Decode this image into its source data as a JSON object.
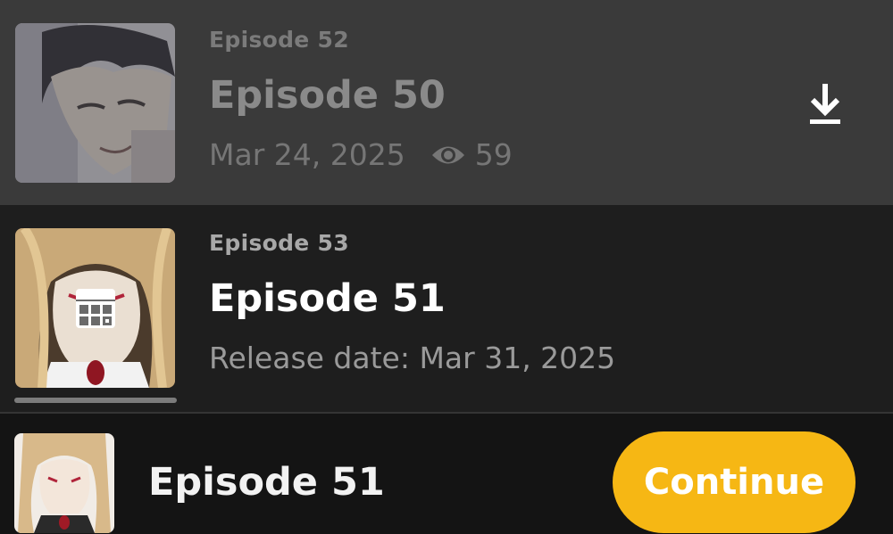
{
  "episodes": [
    {
      "number_label": "Episode 52",
      "title": "Episode 50",
      "date": "Mar 24, 2025",
      "views": "59",
      "icon": "download-icon"
    },
    {
      "number_label": "Episode 53",
      "title": "Episode 51",
      "release_date": "Release date: Mar 31, 2025",
      "icon": "calendar-icon"
    }
  ],
  "continue_bar": {
    "title": "Episode 51",
    "button_label": "Continue"
  },
  "colors": {
    "accent": "#f6b714",
    "viewed_row_bg": "#3a3a3a",
    "row_bg": "#1e1e1e",
    "bar_bg": "#141414"
  }
}
